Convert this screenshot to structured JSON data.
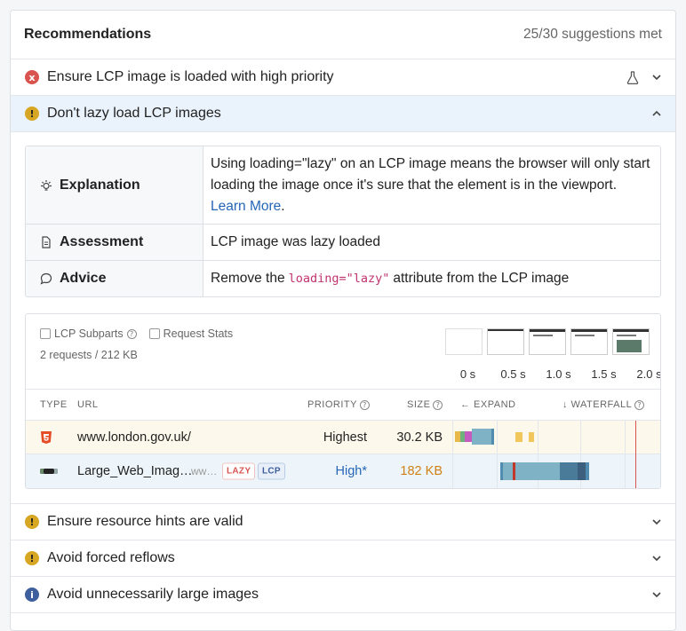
{
  "header": {
    "title": "Recommendations",
    "meta": "25/30 suggestions met"
  },
  "recommendations": [
    {
      "label": "Ensure LCP image is loaded with high priority",
      "status": "error",
      "icon": "x"
    },
    {
      "label": "Don't lazy load LCP images",
      "status": "warning",
      "icon": "!"
    },
    {
      "label": "Ensure resource hints are valid",
      "status": "warning",
      "icon": "!"
    },
    {
      "label": "Avoid forced reflows",
      "status": "warning",
      "icon": "!"
    },
    {
      "label": "Avoid unnecessarily large images",
      "status": "info",
      "icon": "i"
    }
  ],
  "details": {
    "explanation_key": "Explanation",
    "explanation_text": "Using loading=\"lazy\" on an LCP image means the browser will only start loading the image once it's sure that the element is in the viewport.",
    "learn_more": "Learn More",
    "learn_more_suffix": ".",
    "assessment_key": "Assessment",
    "assessment_text": "LCP image was lazy loaded",
    "advice_key": "Advice",
    "advice_prefix": "Remove the",
    "advice_code": "loading=\"lazy\"",
    "advice_suffix": "attribute from the LCP image"
  },
  "waterfall": {
    "checkbox_lcp": "LCP Subparts",
    "checkbox_req": "Request Stats",
    "summary": "2 requests / 212 KB",
    "film_times": [
      "0 s",
      "0.5 s",
      "1.0 s",
      "1.5 s",
      "2.0 s"
    ],
    "columns": {
      "type": "TYPE",
      "url": "URL",
      "priority": "PRIORITY",
      "size": "SIZE",
      "expand": "← EXPAND",
      "waterfall": "↓ WATERFALL"
    },
    "rows": [
      {
        "type_icon": "html5-icon",
        "url": "www.london.gov.uk/",
        "url_sub": "",
        "priority": "Highest",
        "size": "30.2 KB"
      },
      {
        "type_icon": "image-icon",
        "url": "Large_Web_Imag…",
        "url_sub": "ww…",
        "tag_lazy": "LAZY",
        "tag_lcp": "LCP",
        "priority": "High*",
        "size": "182 KB"
      }
    ]
  },
  "colors": {
    "error": "#d9534f",
    "warning": "#d7a623",
    "info": "#3d5f9e",
    "link": "#2566b8",
    "active_row": "#eaf2fb"
  }
}
